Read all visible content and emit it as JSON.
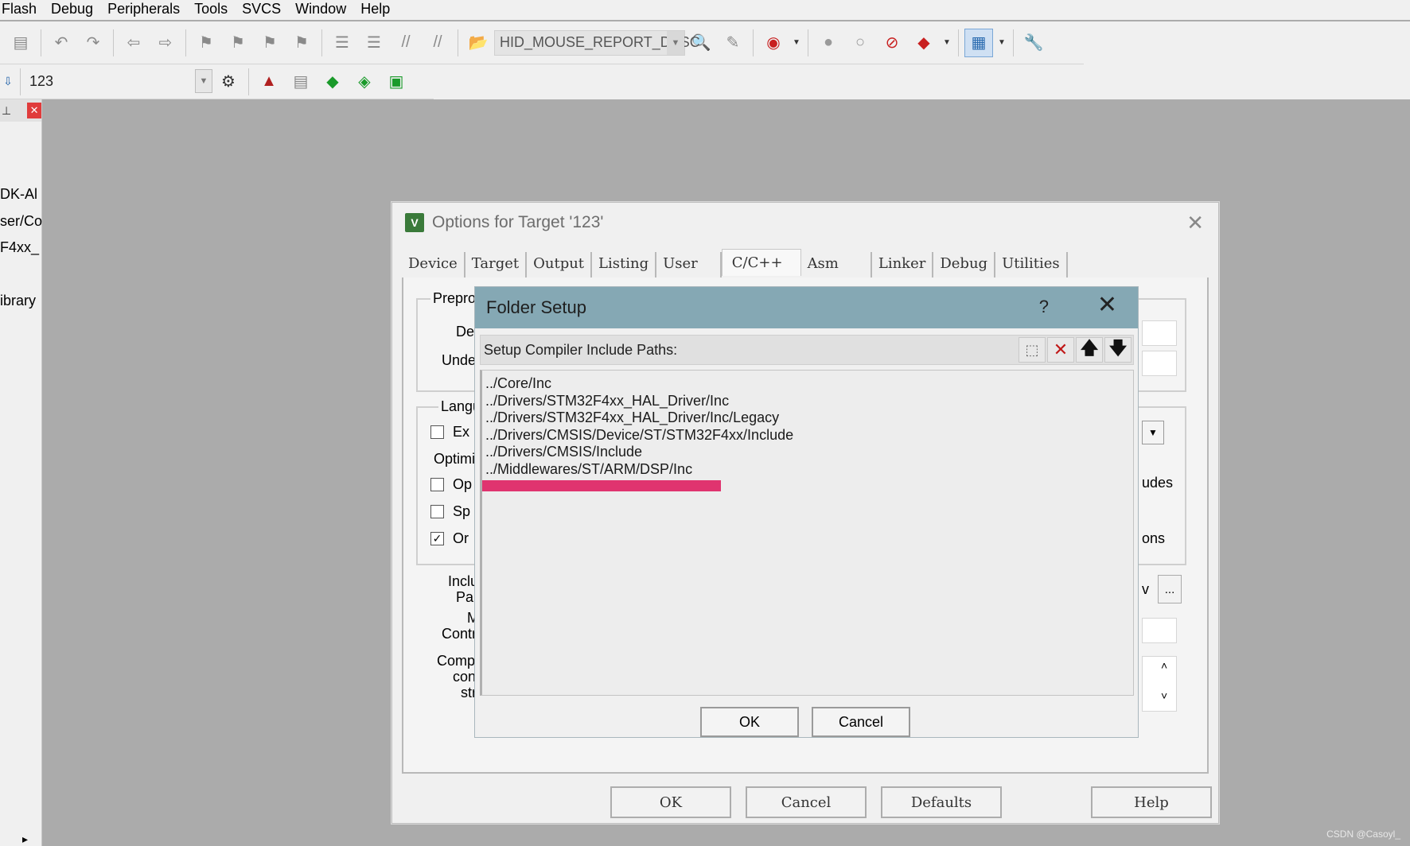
{
  "menubar": {
    "items": [
      "Flash",
      "Debug",
      "Peripherals",
      "Tools",
      "SVCS",
      "Window",
      "Help"
    ]
  },
  "toolbar1": {
    "function_combo": "HID_MOUSE_REPORT_DESC"
  },
  "toolbar2": {
    "target_combo": "123"
  },
  "left_panel": {
    "lines": [
      "DK-Al",
      "ser/Co",
      "F4xx_",
      "ibrary"
    ]
  },
  "options_dialog": {
    "title": "Options for Target '123'",
    "tabs": [
      "Device",
      "Target",
      "Output",
      "Listing",
      "User",
      "C/C++",
      "Asm",
      "Linker",
      "Debug",
      "Utilities"
    ],
    "active_tab": "C/C++",
    "left_labels": {
      "prepro": "Prepro",
      "de": "De",
      "unde": "Unde",
      "langu": "Langu",
      "ex": "Ex",
      "optimiz": "Optimiz",
      "op": "Op",
      "sp": "Sp",
      "or": "Or",
      "inclu": "Inclu",
      "pa": "Pa",
      "m": "M",
      "contr": "Contr",
      "comp": "Comp",
      "con": "con",
      "str": "str"
    },
    "right_labels": {
      "udes": "udes",
      "ons": "ons",
      "v": "v",
      "dots": "..."
    },
    "buttons": {
      "ok": "OK",
      "cancel": "Cancel",
      "defaults": "Defaults",
      "help": "Help"
    }
  },
  "folder_setup": {
    "title": "Folder Setup",
    "help_glyph": "?",
    "close_glyph": "✕",
    "caption": "Setup Compiler Include Paths:",
    "paths": [
      "../Core/Inc",
      "../Drivers/STM32F4xx_HAL_Driver/Inc",
      "../Drivers/STM32F4xx_HAL_Driver/Inc/Legacy",
      "../Drivers/CMSIS/Device/ST/STM32F4xx/Include",
      "../Drivers/CMSIS/Include",
      "../Middlewares/ST/ARM/DSP/Inc"
    ],
    "ok": "OK",
    "cancel": "Cancel"
  },
  "watermark": "CSDN @Casoyl_",
  "colors": {
    "folder_title_bg": "#85a8b4",
    "highlight_bar": "#e0346f",
    "workspace_bg": "#ababab"
  }
}
